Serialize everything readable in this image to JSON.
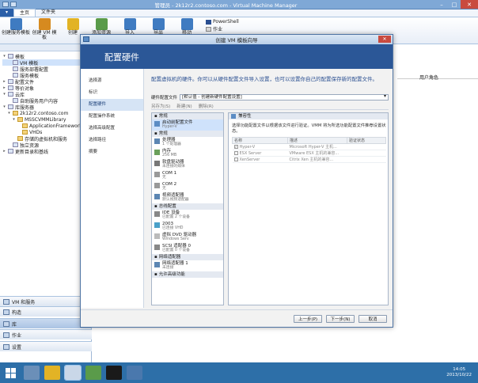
{
  "window": {
    "title": "管理员 - 2k12r2.contoso.com - Virtual Machine Manager"
  },
  "ribbon": {
    "tabs": [
      "主页",
      "文件夹"
    ],
    "buttons": [
      {
        "label": "创建服务模板",
        "icon": "service-template-icon",
        "color": "#3f7bc1"
      },
      {
        "label": "创建 VM 模板",
        "icon": "vm-template-icon",
        "color": "#d68a1f"
      },
      {
        "label": "创建",
        "icon": "create-icon",
        "color": "#e2b325"
      },
      {
        "label": "添加资源",
        "icon": "add-resources-icon",
        "color": "#5a9b4a"
      },
      {
        "label": "导入",
        "icon": "import-icon",
        "color": "#3f7bc1"
      },
      {
        "label": "导出",
        "icon": "export-icon",
        "color": "#3f7bc1"
      },
      {
        "label": "移动",
        "icon": "move-icon",
        "color": "#3f7bc1"
      }
    ],
    "side_items": [
      {
        "label": "PowerShell",
        "icon": "powershell-icon"
      },
      {
        "label": "作业",
        "icon": "jobs-icon"
      }
    ]
  },
  "nav": {
    "tree": [
      {
        "label": "模板",
        "indent": 0,
        "twisty": "▾"
      },
      {
        "label": "VM 模板",
        "indent": 1,
        "selected": true
      },
      {
        "label": "服务部署配置",
        "indent": 1
      },
      {
        "label": "服务模板",
        "indent": 1
      },
      {
        "label": "配置文件",
        "indent": 0,
        "twisty": "▸"
      },
      {
        "label": "等价对象",
        "indent": 0,
        "twisty": "▸"
      },
      {
        "label": "云库",
        "indent": 0,
        "twisty": "▾"
      },
      {
        "label": "自助服务用户内容",
        "indent": 1
      },
      {
        "label": "库服务器",
        "indent": 0,
        "twisty": "▾"
      },
      {
        "label": "2k12r2.contoso.com",
        "indent": 1,
        "twisty": "▾",
        "folder": true
      },
      {
        "label": "MSSCVMMLibrary",
        "indent": 2,
        "twisty": "▾",
        "folder": true
      },
      {
        "label": "ApplicationFrameworks",
        "indent": 3,
        "folder": true
      },
      {
        "label": "VHDs",
        "indent": 3,
        "folder": true
      },
      {
        "label": "存储的虚拟机和服务",
        "indent": 2,
        "folder": true
      },
      {
        "label": "独立资源",
        "indent": 1
      },
      {
        "label": "更新目录和基线",
        "indent": 0,
        "twisty": "▸"
      }
    ],
    "workspaces": [
      "VM 和服务",
      "构造",
      "库",
      "作业",
      "设置"
    ],
    "active_workspace": "库"
  },
  "content": {
    "column_user_role": "用户角色"
  },
  "wizard": {
    "title": "创建 VM 模板向导",
    "banner": "配置硬件",
    "steps": [
      "选择源",
      "标识",
      "配置硬件",
      "配置操作系统",
      "选择高级配置",
      "选择路径",
      "摘要"
    ],
    "active_step": "配置硬件",
    "intro": "配置虚拟机的硬件。你可以从硬件配置文件导入设置，也可以设置你自己的配置保存新的配置文件。",
    "profile_label": "硬件配置文件",
    "profile_value": "[默认值 - 创建新硬件配置设置]",
    "toolbar": [
      "另存为(S)",
      "新建(N)",
      "删除(R)"
    ],
    "hw_list": [
      {
        "type": "cat",
        "label": "常规"
      },
      {
        "type": "item",
        "label": "启动前配置文件",
        "sub": "Hyper-V",
        "icon": "compat-icon",
        "color": "#5b8cc4",
        "selected": true
      },
      {
        "type": "cat",
        "label": "常规"
      },
      {
        "type": "item",
        "label": "处理器",
        "sub": "1 个处理器",
        "icon": "processor-icon",
        "color": "#5c86b3"
      },
      {
        "type": "item",
        "label": "内存",
        "sub": "256 MB",
        "icon": "memory-icon",
        "color": "#6aa05c"
      },
      {
        "type": "item",
        "label": "软盘驱动器",
        "sub": "未连接的媒体",
        "icon": "floppy-icon",
        "color": "#777777"
      },
      {
        "type": "item",
        "label": "COM 1",
        "sub": "无",
        "icon": "com-icon",
        "color": "#999999"
      },
      {
        "type": "item",
        "label": "COM 2",
        "sub": "无",
        "icon": "com-icon",
        "color": "#999999"
      },
      {
        "type": "item",
        "label": "视频适配器",
        "sub": "默认视频适配器",
        "icon": "video-adapter-icon",
        "color": "#5c86b3"
      },
      {
        "type": "cat",
        "label": "总线配置"
      },
      {
        "type": "item",
        "label": "IDE 设备",
        "sub": "已配置 2 个设备",
        "icon": "ide-icon",
        "color": "#888888"
      },
      {
        "type": "item",
        "label": "2003",
        "sub": "已连接 VHD",
        "icon": "vhd-icon",
        "color": "#4aa0c9"
      },
      {
        "type": "item",
        "label": "虚拟 DVD 驱动器",
        "sub": "Windows Serv",
        "icon": "dvd-icon",
        "color": "#bbbbbb"
      },
      {
        "type": "item",
        "label": "SCSI 适配器 0",
        "sub": "已配置 0 个设备",
        "icon": "scsi-icon",
        "color": "#888888"
      },
      {
        "type": "cat",
        "label": "网络适配器"
      },
      {
        "type": "item",
        "label": "网络适配器 1",
        "sub": "未连接",
        "icon": "network-adapter-icon",
        "color": "#5c86b3"
      },
      {
        "type": "cat",
        "label": "允许高级功能"
      }
    ],
    "compat": {
      "heading": "兼容性",
      "desc": "选择功能配置文件以根据该文件进行验证。VMM 将为所选功能配置文件推荐设置状态。",
      "columns": [
        "名称",
        "描述",
        "验证状态"
      ],
      "rows": [
        {
          "name": "Hyper-V",
          "desc": "Microsoft Hyper-V 主机...",
          "status": "",
          "checked": true
        },
        {
          "name": "ESX Server",
          "desc": "VMware ESX 主机的兼容...",
          "status": "",
          "checked": false
        },
        {
          "name": "XenServer",
          "desc": "Citrix Xen 主机的兼容...",
          "status": "",
          "checked": false
        }
      ]
    },
    "buttons": {
      "prev": "上一步(P)",
      "next": "下一步(N)",
      "cancel": "取消"
    }
  },
  "taskbar": {
    "time": "14:05",
    "date": "2013/10/22",
    "apps": [
      {
        "name": "start-icon",
        "color": "#ffffff"
      },
      {
        "name": "server-manager-icon",
        "color": "#6b8fb8"
      },
      {
        "name": "file-explorer-icon",
        "color": "#e2b325"
      },
      {
        "name": "vmm-console-icon",
        "color": "#c9d7e8"
      },
      {
        "name": "hyper-v-manager-icon",
        "color": "#5a9b4a"
      },
      {
        "name": "cmd-icon",
        "color": "#1a1a1a"
      },
      {
        "name": "vm-connection-icon",
        "color": "#4a78ad"
      }
    ]
  }
}
